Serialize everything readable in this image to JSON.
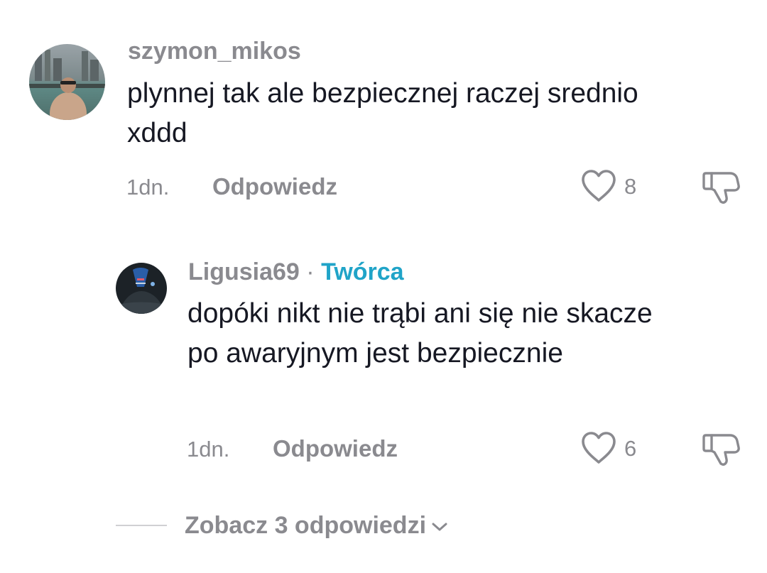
{
  "comments": [
    {
      "username": "szymon_mikos",
      "text": "plynnej tak ale bezpiecznej raczej srednio xddd",
      "time": "1dn.",
      "reply_label": "Odpowiedz",
      "likes": "8"
    }
  ],
  "reply": {
    "username": "Ligusia69",
    "separator": "·",
    "badge": "Twórca",
    "text": "dopóki nikt nie trąbi ani się nie skacze po awaryjnym jest bezpiecznie",
    "time": "1dn.",
    "reply_label": "Odpowiedz",
    "likes": "6"
  },
  "view_replies": {
    "label": "Zobacz 3 odpowiedzi",
    "icon": "chevron-down-icon"
  },
  "colors": {
    "secondary_text": "#8a8a8f",
    "primary_text": "#161823",
    "creator_badge": "#20a4c8"
  }
}
